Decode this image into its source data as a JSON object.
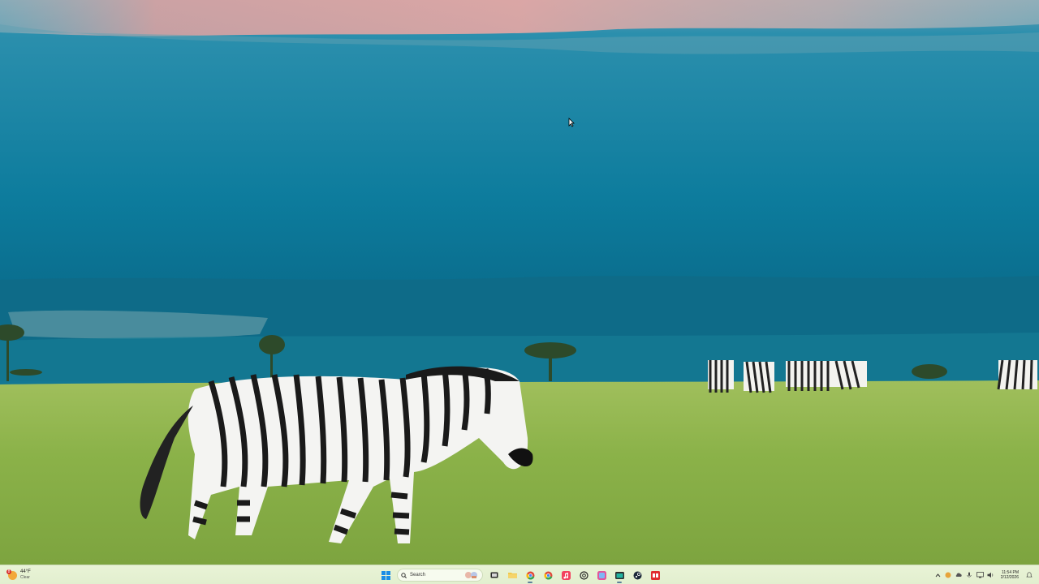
{
  "desktop": {
    "wallpaper": "zebra-grassland-wallpaper"
  },
  "taskbar": {
    "weather": {
      "temperature": "44°F",
      "condition": "Clear",
      "alert_count": "8"
    },
    "search": {
      "placeholder": "Search"
    },
    "pinned_apps": [
      {
        "name": "start",
        "icon": "windows-logo-icon"
      },
      {
        "name": "task-view",
        "icon": "task-view-icon"
      },
      {
        "name": "file-explorer",
        "icon": "folder-icon"
      },
      {
        "name": "chrome",
        "icon": "chrome-icon"
      },
      {
        "name": "chrome-alt",
        "icon": "chrome-icon"
      },
      {
        "name": "music",
        "icon": "music-app-icon"
      },
      {
        "name": "chatgpt",
        "icon": "openai-icon"
      },
      {
        "name": "photos",
        "icon": "photos-icon"
      },
      {
        "name": "terminal",
        "icon": "terminal-icon"
      },
      {
        "name": "steam",
        "icon": "steam-icon"
      },
      {
        "name": "app-bf",
        "icon": "bf-app-icon"
      }
    ],
    "tray": {
      "time": "11:54 PM",
      "date": "2/12/2026"
    }
  },
  "colors": {
    "taskbar_bg": "#e4f0d1",
    "sky": "#0f7a98",
    "grass": "#8fb34a"
  }
}
